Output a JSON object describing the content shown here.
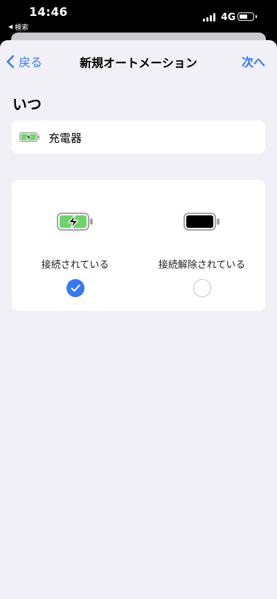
{
  "status_bar": {
    "time": "14:46",
    "back_app": "検索",
    "back_icon": "triangle-left-icon",
    "network": "4G"
  },
  "nav": {
    "back_label": "戻る",
    "title": "新規オートメーション",
    "next_label": "次へ"
  },
  "section": {
    "title": "いつ"
  },
  "trigger": {
    "label": "充電器",
    "icon": "battery-charging-icon"
  },
  "options": [
    {
      "label": "接続されている",
      "icon": "battery-charging-icon",
      "selected": true
    },
    {
      "label": "接続解除されている",
      "icon": "battery-full-icon",
      "selected": false
    }
  ],
  "colors": {
    "accent": "#3478f6",
    "battery_green": "#6dd46a",
    "sheet_bg": "#f1f0f6"
  }
}
